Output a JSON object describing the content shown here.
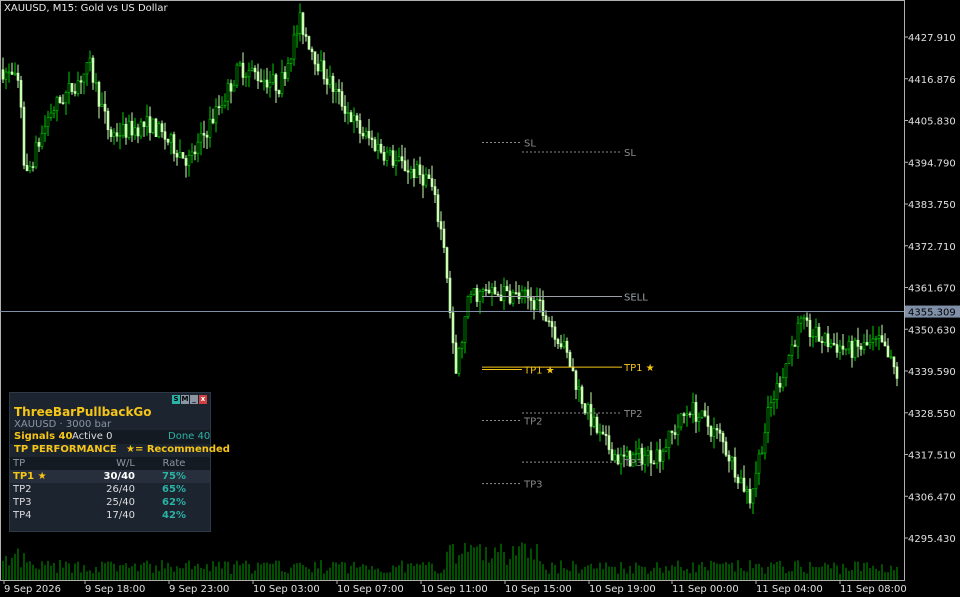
{
  "window": {
    "title": "XAUUSD, M15:  Gold vs US Dollar"
  },
  "colors": {
    "background": "#000000",
    "bull": "#00d000",
    "bear": "#c8ffb0",
    "price_line": "#8090a8",
    "sell_line": "#9aa0a6",
    "tp1_line": "#f5c518",
    "level_gray": "#8a8a8a",
    "accent_gold": "#f5c518",
    "accent_teal": "#2ab3a6"
  },
  "price_axis": {
    "ticks": [
      "4427.910",
      "4416.876",
      "4405.830",
      "4394.790",
      "4383.750",
      "4372.710",
      "4361.670",
      "4350.630",
      "4339.590",
      "4328.550",
      "4317.510",
      "4306.470",
      "4295.430"
    ],
    "current_price": "4355.309"
  },
  "time_axis": {
    "ticks": [
      "9 Sep 2026",
      "9 Sep 18:00",
      "9 Sep 23:00",
      "10 Sep 03:00",
      "10 Sep 07:00",
      "10 Sep 11:00",
      "10 Sep 15:00",
      "10 Sep 19:00",
      "11 Sep 00:00",
      "11 Sep 04:00",
      "11 Sep 08:00"
    ]
  },
  "levels": {
    "sl_label": "SL",
    "sell_label": "SELL",
    "tp1_label": "TP1 ★",
    "tp2_label": "TP2",
    "tp3_label": "TP3"
  },
  "panel": {
    "controls": [
      "S",
      "M",
      "_",
      "x"
    ],
    "indicator_name": "ThreeBarPullbackGo",
    "subtitle": "XAUUSD · 3000 bar",
    "signals": "Signals 40",
    "active": "Active 0",
    "done": "Done 40",
    "perf_title": "TP PERFORMANCE",
    "recommended": "★= Recommended",
    "columns": [
      "TP",
      "W/L",
      "Rate"
    ],
    "rows": [
      {
        "tp": "TP1 ★",
        "wl": "30/40",
        "rate": "75%"
      },
      {
        "tp": "TP2",
        "wl": "26/40",
        "rate": "65%"
      },
      {
        "tp": "TP3",
        "wl": "25/40",
        "rate": "62%"
      },
      {
        "tp": "TP4",
        "wl": "17/40",
        "rate": "42%"
      }
    ]
  }
}
